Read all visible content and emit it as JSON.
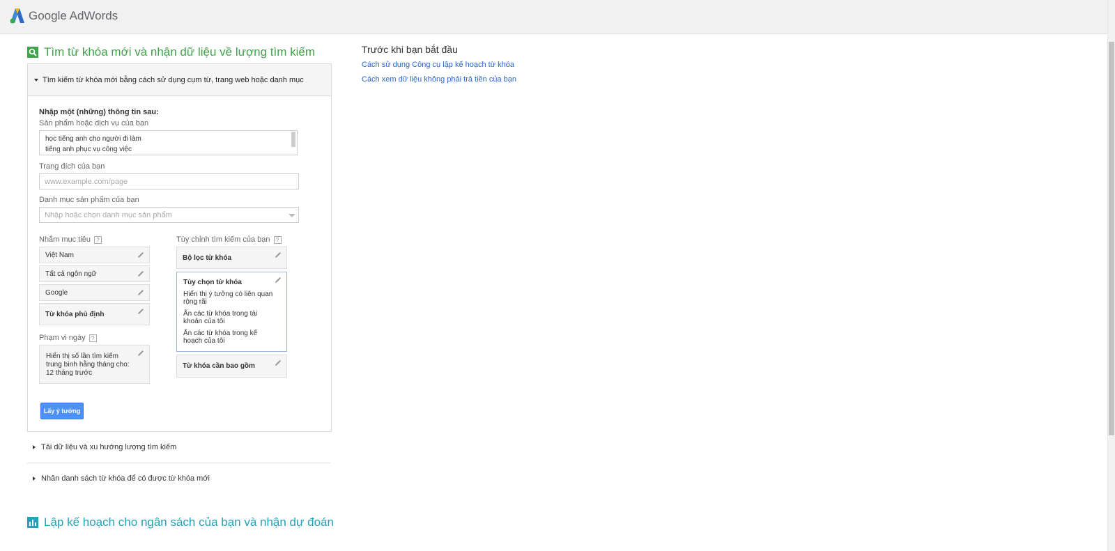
{
  "header": {
    "logo_google": "Google",
    "logo_product": "AdWords"
  },
  "find_section": {
    "title": "Tìm từ khóa mới và nhận dữ liệu về lượng tìm kiếm"
  },
  "panel": {
    "heading": "Tìm kiếm từ khóa mới bằng cách sử dụng cụm từ, trang web hoặc danh mục",
    "instructions": "Nhập một (những) thông tin sau:",
    "product_label": "Sản phẩm hoặc dịch vụ của bạn",
    "product_lines": [
      "học tiếng anh cho người đi làm",
      "tiếng anh phục vụ công việc"
    ],
    "landing_label": "Trang đích của bạn",
    "landing_placeholder": "www.example.com/page",
    "category_label": "Danh mục sản phẩm của bạn",
    "category_placeholder": "Nhập hoặc chọn danh mục sản phẩm",
    "targeting_label": "Nhắm mục tiêu",
    "targeting_items": [
      "Việt Nam",
      "Tất cả ngôn ngữ",
      "Google"
    ],
    "negative_label": "Từ khóa phủ định",
    "date_label": "Phạm vi ngày",
    "date_value": "Hiển thị số lần tìm kiếm trung bình hằng tháng cho: 12 tháng trước",
    "customize_label": "Tùy chỉnh tìm kiếm của bạn",
    "keyword_filter": "Bộ lọc từ khóa",
    "keyword_options": "Tùy chọn từ khóa",
    "keyword_options_lines": [
      "Hiển thị ý tưởng có liên quan rộng rãi",
      "Ẩn các từ khóa trong tài khoản của tôi",
      "Ẩn các từ khóa trong kế hoạch của tôi"
    ],
    "keywords_to_include": "Từ khóa cần bao gồm",
    "get_ideas_button": "Lấy ý tưởng",
    "help": "?"
  },
  "collapsed": [
    "Tải dữ liệu và xu hướng lượng tìm kiếm",
    "Nhân danh sách từ khóa để có được từ khóa mới"
  ],
  "plan_section": {
    "title": "Lập kế hoạch cho ngân sách của bạn và nhận dự đoán"
  },
  "sidebar": {
    "title": "Trước khi bạn bắt đầu",
    "links": [
      "Cách sử dụng Công cụ lập kế hoạch từ khóa",
      "Cách xem dữ liệu không phải trả tiền của bạn"
    ]
  },
  "colors": {
    "green": "#3fa34a",
    "teal": "#23a1b8",
    "link": "#2a66c9",
    "button": "#4d90fe"
  }
}
